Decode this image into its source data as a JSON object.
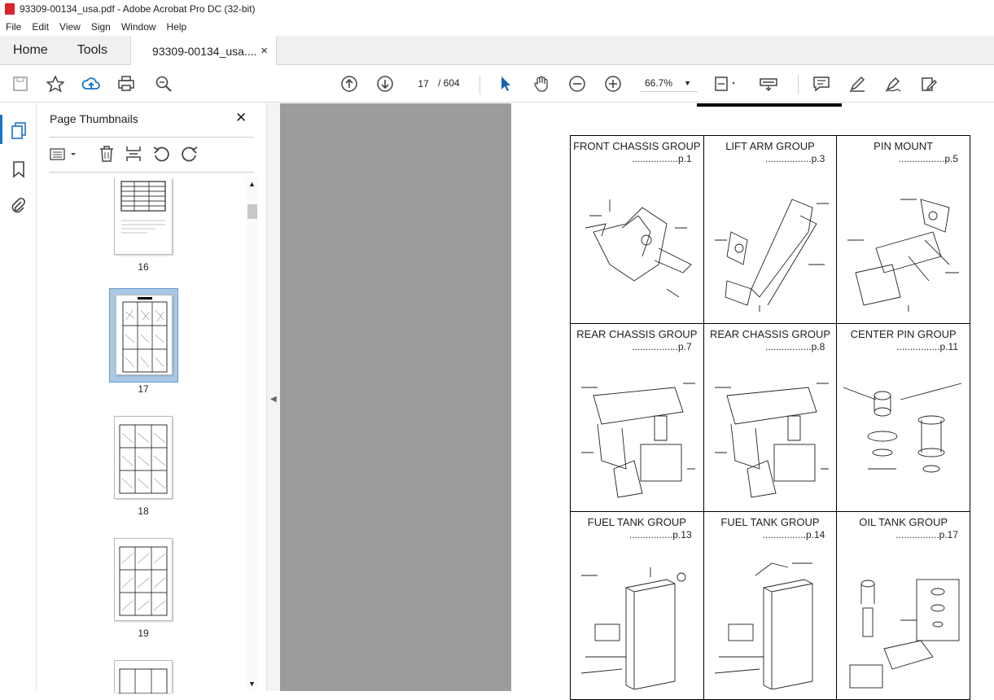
{
  "window": {
    "title": "93309-00134_usa.pdf - Adobe Acrobat Pro DC (32-bit)"
  },
  "menu": [
    "File",
    "Edit",
    "View",
    "Sign",
    "Window",
    "Help"
  ],
  "tabs": {
    "home": "Home",
    "tools": "Tools",
    "doc": "93309-00134_usa....",
    "close": "×"
  },
  "toolbar": {
    "current_page": "17",
    "page_total": "/ 604",
    "zoom": "66.7%"
  },
  "panel": {
    "title": "Page Thumbnails",
    "close": "✕"
  },
  "thumbnails": [
    {
      "label": "16"
    },
    {
      "label": "17",
      "selected": true
    },
    {
      "label": "18"
    },
    {
      "label": "19"
    }
  ],
  "document": {
    "cells": [
      {
        "title": "FRONT CHASSIS GROUP",
        "page": ".................p.1"
      },
      {
        "title": "LIFT ARM GROUP",
        "page": ".................p.3"
      },
      {
        "title": "PIN MOUNT",
        "page": ".................p.5"
      },
      {
        "title": "REAR CHASSIS GROUP",
        "page": ".................p.7"
      },
      {
        "title": "REAR CHASSIS GROUP",
        "page": ".................p.8"
      },
      {
        "title": "CENTER PIN GROUP",
        "page": "................p.11"
      },
      {
        "title": "FUEL TANK GROUP",
        "page": "................p.13"
      },
      {
        "title": "FUEL TANK GROUP",
        "page": "................p.14"
      },
      {
        "title": "OIL TANK GROUP",
        "page": "................p.17"
      }
    ]
  }
}
